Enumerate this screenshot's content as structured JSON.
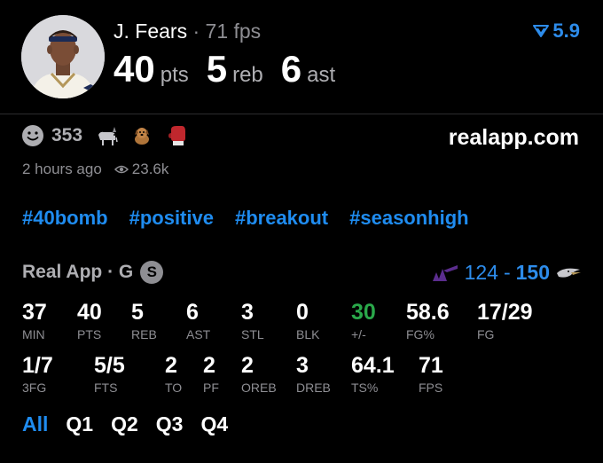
{
  "player": {
    "name": "J. Fears",
    "separator": "·",
    "fps": "71 fps",
    "rating": "5.9",
    "pts": "40",
    "pts_label": "pts",
    "reb": "5",
    "reb_label": "reb",
    "ast": "6",
    "ast_label": "ast"
  },
  "reactions": {
    "count": "353",
    "icons": [
      "smiley-face-icon",
      "goat-icon",
      "dog-icon",
      "boxing-glove-icon"
    ]
  },
  "site": "realapp.com",
  "meta": {
    "time": "2 hours ago",
    "views": "23.6k"
  },
  "tags": [
    "#40bomb",
    "#positive",
    "#breakout",
    "#seasonhigh"
  ],
  "game": {
    "label": "Real App · G",
    "badge": "S",
    "score_left": "124",
    "score_sep": "-",
    "score_right": "150"
  },
  "stats_row1": [
    {
      "value": "37",
      "label": "MIN"
    },
    {
      "value": "40",
      "label": "PTS"
    },
    {
      "value": "5",
      "label": "REB"
    },
    {
      "value": "6",
      "label": "AST"
    },
    {
      "value": "3",
      "label": "STL"
    },
    {
      "value": "0",
      "label": "BLK"
    },
    {
      "value": "30",
      "label": "+/-"
    },
    {
      "value": "58.6",
      "label": "FG%"
    },
    {
      "value": "17/29",
      "label": "FG"
    }
  ],
  "stats_row2": [
    {
      "value": "1/7",
      "label": "3FG"
    },
    {
      "value": "5/5",
      "label": "FTS"
    },
    {
      "value": "2",
      "label": "TO"
    },
    {
      "value": "2",
      "label": "PF"
    },
    {
      "value": "2",
      "label": "OREB"
    },
    {
      "value": "3",
      "label": "DREB"
    },
    {
      "value": "64.1",
      "label": "TS%"
    },
    {
      "value": "71",
      "label": "FPS"
    }
  ],
  "quarters": [
    "All",
    "Q1",
    "Q2",
    "Q3",
    "Q4"
  ],
  "colors": {
    "accent": "#1f8cf0",
    "positive": "#2aa84a",
    "muted": "#8e8e93"
  }
}
